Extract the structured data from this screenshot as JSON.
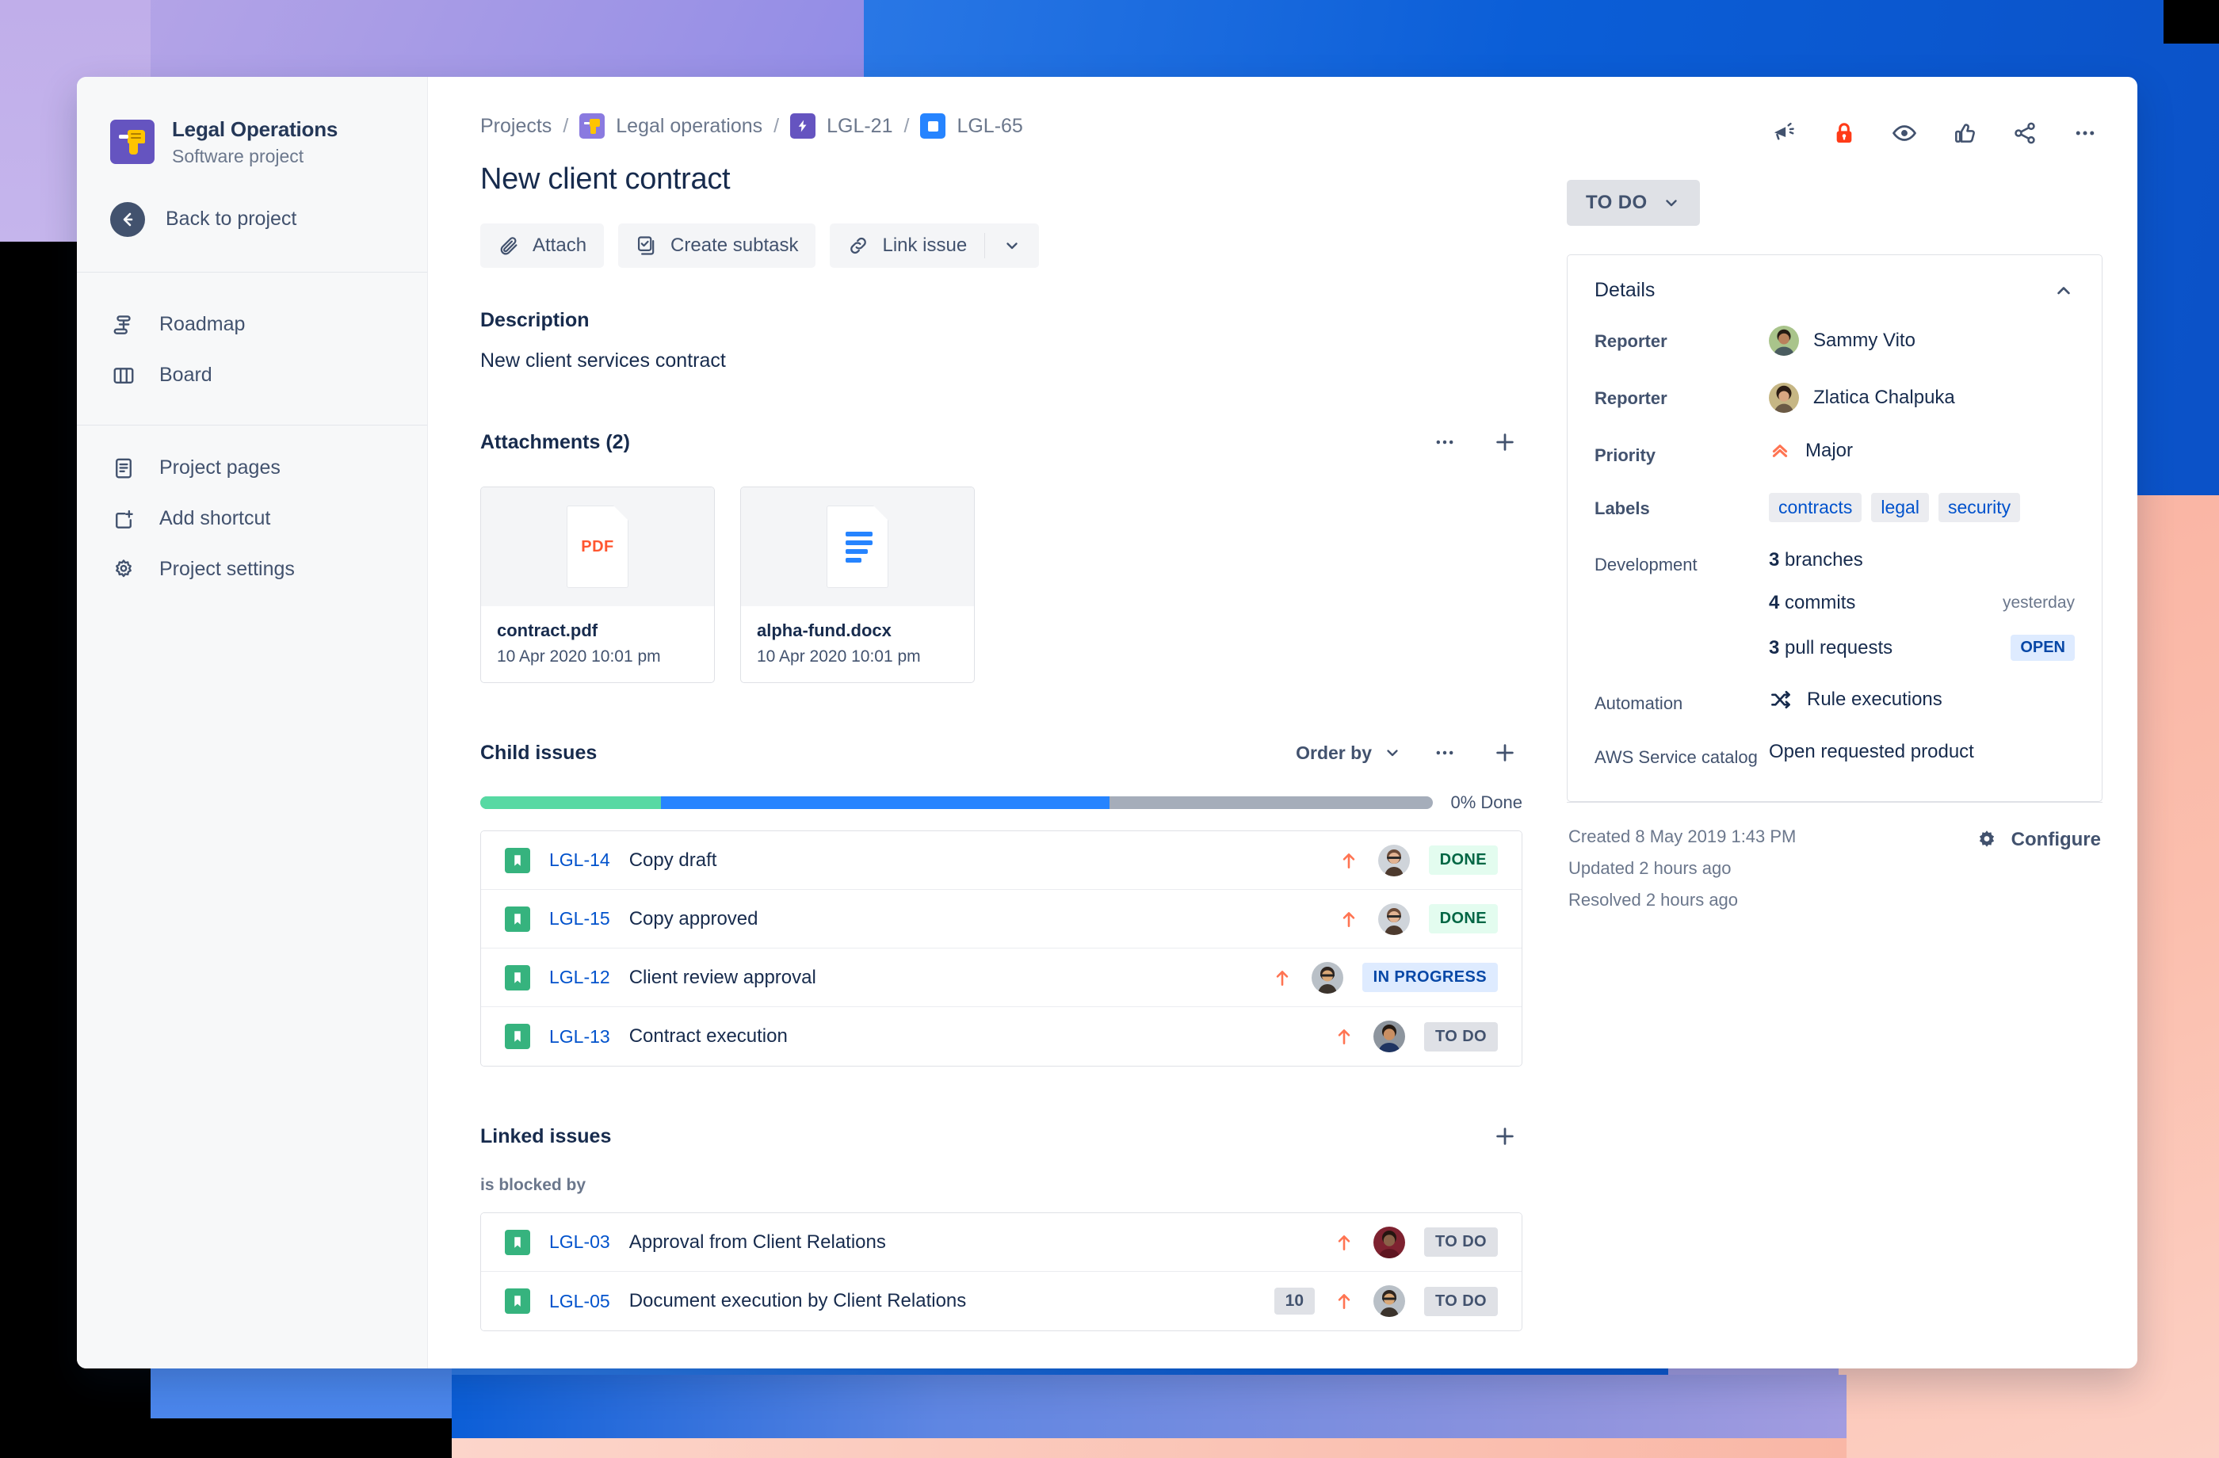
{
  "sidebar": {
    "project_name": "Legal Operations",
    "project_type": "Software project",
    "back_label": "Back to project",
    "items": [
      {
        "label": "Roadmap",
        "icon": "roadmap-icon"
      },
      {
        "label": "Board",
        "icon": "board-icon"
      },
      {
        "label": "Project pages",
        "icon": "page-icon"
      },
      {
        "label": "Add shortcut",
        "icon": "add-shortcut-icon"
      },
      {
        "label": "Project settings",
        "icon": "gear-icon"
      }
    ]
  },
  "breadcrumb": {
    "projects": "Projects",
    "project": "Legal operations",
    "epic": "LGL-21",
    "issue": "LGL-65",
    "separator": "/"
  },
  "issue": {
    "title": "New client contract",
    "actions": [
      {
        "label": "Attach",
        "icon": "paperclip-icon"
      },
      {
        "label": "Create subtask",
        "icon": "subtask-icon"
      },
      {
        "label": "Link issue",
        "icon": "link-icon"
      }
    ]
  },
  "description": {
    "heading": "Description",
    "body": "New client services contract"
  },
  "attachments": {
    "heading": "Attachments (2)",
    "items": [
      {
        "name": "contract.pdf",
        "date": "10 Apr 2020 10:01 pm",
        "kind": "pdf",
        "tag": "PDF"
      },
      {
        "name": "alpha-fund.docx",
        "date": "10 Apr 2020 10:01 pm",
        "kind": "doc",
        "tag": ""
      }
    ]
  },
  "child_issues": {
    "heading": "Child issues",
    "order_by": "Order by",
    "progress": {
      "done_text": "0% Done",
      "green_pct": 19,
      "blue_pct": 47,
      "grey_pct": 34
    },
    "rows": [
      {
        "key": "LGL-14",
        "summary": "Copy draft",
        "points": "",
        "status": "DONE",
        "status_kind": "done",
        "avatar": "woman-glasses"
      },
      {
        "key": "LGL-15",
        "summary": "Copy approved",
        "points": "",
        "status": "DONE",
        "status_kind": "done",
        "avatar": "woman-glasses"
      },
      {
        "key": "LGL-12",
        "summary": "Client review approval",
        "points": "",
        "status": "IN PROGRESS",
        "status_kind": "progress",
        "avatar": "person-glasses"
      },
      {
        "key": "LGL-13",
        "summary": "Contract execution",
        "points": "",
        "status": "TO DO",
        "status_kind": "todo",
        "avatar": "young-man"
      }
    ]
  },
  "linked_issues": {
    "heading": "Linked issues",
    "group_label": "is blocked by",
    "rows": [
      {
        "key": "LGL-03",
        "summary": "Approval from Client Relations",
        "points": "",
        "status": "TO DO",
        "status_kind": "todo",
        "avatar": "man-maroon"
      },
      {
        "key": "LGL-05",
        "summary": "Document execution by Client Relations",
        "points": "10",
        "status": "TO DO",
        "status_kind": "todo",
        "avatar": "person-glasses"
      }
    ]
  },
  "right_panel": {
    "top_icons": [
      {
        "name": "megaphone-icon"
      },
      {
        "name": "lock-icon"
      },
      {
        "name": "eye-icon"
      },
      {
        "name": "thumbs-up-icon"
      },
      {
        "name": "share-icon"
      },
      {
        "name": "more-icon"
      }
    ],
    "status": "TO DO",
    "details_title": "Details",
    "fields": {
      "reporter_label_1": "Reporter",
      "reporter_value_1": "Sammy Vito",
      "reporter_label_2": "Reporter",
      "reporter_value_2": "Zlatica Chalpuka",
      "priority_label": "Priority",
      "priority_value": "Major",
      "labels_label": "Labels",
      "labels": [
        "contracts",
        "legal",
        "security"
      ],
      "development_label": "Development",
      "development": [
        {
          "count": "3",
          "text": " branches",
          "meta": "",
          "pill": ""
        },
        {
          "count": "4",
          "text": " commits",
          "meta": "yesterday",
          "pill": ""
        },
        {
          "count": "3",
          "text": " pull requests",
          "meta": "",
          "pill": "OPEN"
        }
      ],
      "automation_label": "Automation",
      "automation_value": "Rule executions",
      "aws_label": "AWS Service catalog",
      "aws_value": "Open requested product"
    },
    "footer": {
      "created": "Created 8 May 2019 1:43 PM",
      "updated": "Updated 2 hours ago",
      "resolved": "Resolved 2 hours ago",
      "configure": "Configure"
    }
  },
  "colors": {
    "brand_blue": "#0052cc",
    "link_blue": "#0052cc",
    "purple": "#6554c0",
    "green": "#36b37e",
    "orange": "#ff7452",
    "red_lock": "#ff3b18",
    "text_dark": "#172b4d",
    "text_muted": "#6b778c"
  }
}
